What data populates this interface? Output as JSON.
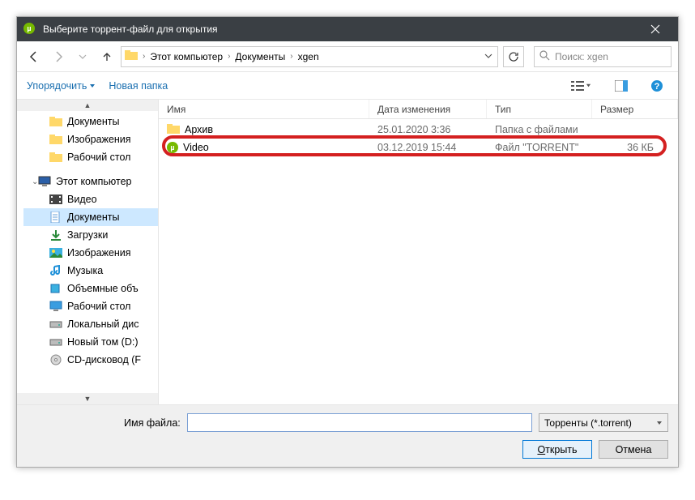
{
  "title": "Выберите торрент-файл для открытия",
  "breadcrumb": {
    "root": "Этот компьютер",
    "mid": "Документы",
    "leaf": "xgen"
  },
  "search_placeholder": "Поиск: xgen",
  "toolbar": {
    "organize": "Упорядочить",
    "new_folder": "Новая папка"
  },
  "sidebar": {
    "items": [
      {
        "label": "Документы",
        "icon": "folder"
      },
      {
        "label": "Изображения",
        "icon": "folder"
      },
      {
        "label": "Рабочий стол",
        "icon": "folder"
      },
      {
        "label": "Этот компьютер",
        "icon": "pc",
        "expand": true
      },
      {
        "label": "Видео",
        "icon": "video"
      },
      {
        "label": "Документы",
        "icon": "docs",
        "selected": true
      },
      {
        "label": "Загрузки",
        "icon": "downloads"
      },
      {
        "label": "Изображения",
        "icon": "pictures"
      },
      {
        "label": "Музыка",
        "icon": "music"
      },
      {
        "label": "Объемные объ",
        "icon": "3d"
      },
      {
        "label": "Рабочий стол",
        "icon": "desktop"
      },
      {
        "label": "Локальный дис",
        "icon": "drive"
      },
      {
        "label": "Новый том (D:)",
        "icon": "drive"
      },
      {
        "label": "CD-дисковод (F",
        "icon": "cd"
      }
    ]
  },
  "columns": {
    "name": "Имя",
    "date": "Дата изменения",
    "type": "Тип",
    "size": "Размер"
  },
  "rows": [
    {
      "icon": "folder",
      "name": "Архив",
      "date": "25.01.2020 3:36",
      "type": "Папка с файлами",
      "size": ""
    },
    {
      "icon": "torrent",
      "name": "Video",
      "date": "03.12.2019 15:44",
      "type": "Файл \"TORRENT\"",
      "size": "36 КБ",
      "highlight": true
    }
  ],
  "bottom": {
    "filename_label": "Имя файла:",
    "filename_value": "",
    "filetype": "Торренты (*.torrent)",
    "open_prefix": "О",
    "open_rest": "ткрыть",
    "cancel": "Отмена"
  }
}
